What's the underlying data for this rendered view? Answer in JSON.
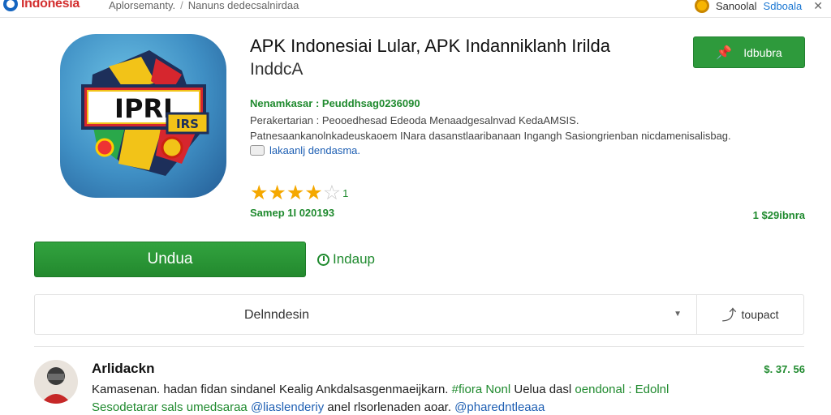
{
  "header": {
    "logo_text": "Indonesia",
    "breadcrumb": [
      "Aplorsemanty.",
      "Nanuns dedecsalnirdaa"
    ],
    "user_name": "Sanoolal",
    "link": "Sdboala"
  },
  "app": {
    "icon_text": "IPRI",
    "icon_badge": "IRS",
    "title": "APK Indonesiai Lular, APK Indanniklanh Irilda",
    "subtitle": "InddcA",
    "install_button": "Idbubra",
    "meta": {
      "line1_label": "Nenamkasar :",
      "line1_value": "Peuddhsag0236090",
      "line2": "Perakertarian : Peooedhesad Edeoda Menaadgesalnvad KedaAMSIS.",
      "line3": "Patnesaankanolnkadeuskaoem INara dasanstlaaribanaan Ingangh Sasiongrienban nicdamenisalisbag.",
      "line4": "lakaanlj dendasma."
    },
    "rating": {
      "value": 4,
      "max": 5,
      "count": "1"
    },
    "date": "Samep 1I 020193",
    "price": "1 $29ibnra"
  },
  "actions": {
    "download": "Undua",
    "install": "Indaup",
    "select_value": "Delnndesin",
    "share": "toupact"
  },
  "review": {
    "name": "Arlidackn",
    "price": "$. 37. 56",
    "line1_text": "Kamasenan. hadan fidan sindanel Kealig Ankdalsasgenmaeijkarn.",
    "line1_green": "#fiora Nonl",
    "line1_mid": "Uelua dasl",
    "line1_green2": "oendonal : Edolnl",
    "line2_text": "Sesodetarar sals umedsaraa",
    "line2_blue": "@liaslenderiy",
    "line2_mid": "anel rlsorlenaden aoar.",
    "line2_blue2": "@pharedntleaaa"
  },
  "colors": {
    "accent_green": "#2e9a3c",
    "link_blue": "#1e5fb3",
    "star": "#f5a800"
  },
  "icons": [
    "logo-icon",
    "user-icon",
    "close-icon",
    "pin-icon",
    "clock-icon",
    "chevron-down-icon",
    "share-icon",
    "star-icon"
  ]
}
